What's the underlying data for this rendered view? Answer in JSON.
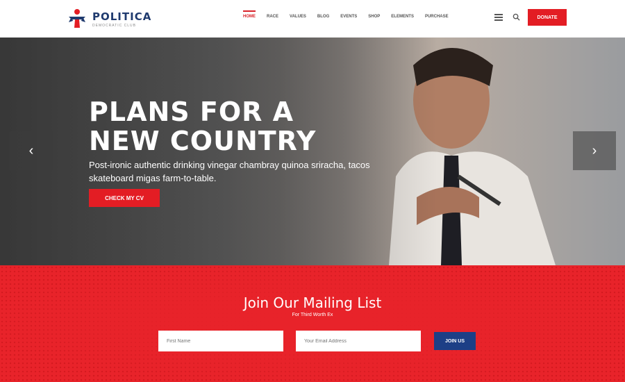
{
  "brand": {
    "name": "POLITICA",
    "tagline": "DEMOCRATIC CLUB",
    "colors": {
      "red": "#e31d24",
      "navy": "#1f3a6e"
    }
  },
  "nav": {
    "items": [
      "HOME",
      "RACE",
      "VALUES",
      "BLOG",
      "EVENTS",
      "SHOP",
      "ELEMENTS",
      "PURCHASE"
    ],
    "active": "HOME",
    "icons": [
      "menu-icon",
      "search-icon"
    ],
    "donate_label": "DONATE"
  },
  "hero": {
    "title_line1": "PLANS FOR A",
    "title_line2": "NEW COUNTRY",
    "subtitle": "Post-ironic authentic drinking vinegar chambray quinoa sriracha, tacos skateboard migas farm-to-table.",
    "cta_label": "CHECK MY CV",
    "prev_icon": "chevron-left-icon",
    "next_icon": "chevron-right-icon"
  },
  "mailing": {
    "title": "Join Our Mailing List",
    "subtitle": "For Third Worth Ex",
    "name_placeholder": "First Name",
    "email_placeholder": "Your Email Address",
    "join_label": "JOIN US"
  }
}
